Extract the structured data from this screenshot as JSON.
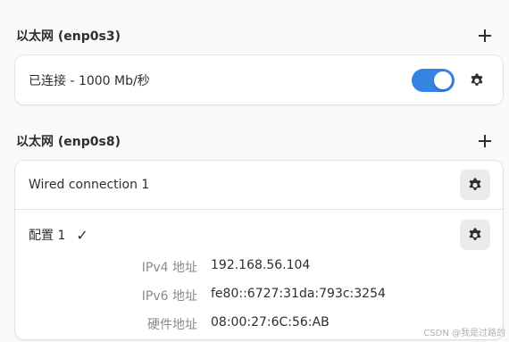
{
  "sections": [
    {
      "title": "以太网 (enp0s3)",
      "connection": {
        "status": "已连接 - 1000 Mb/秒",
        "toggle_on": true
      }
    },
    {
      "title": "以太网 (enp0s8)",
      "connection_name": "Wired connection 1",
      "profile": {
        "name": "配置 1",
        "check": "✓",
        "details": [
          {
            "label": "IPv4 地址",
            "value": "192.168.56.104"
          },
          {
            "label": "IPv6 地址",
            "value": "fe80::6727:31da:793c:3254"
          },
          {
            "label": "硬件地址",
            "value": "08:00:27:6C:56:AB"
          }
        ]
      }
    }
  ],
  "accent_color": "#3584e4",
  "watermark": "CSDN @我是过路的"
}
